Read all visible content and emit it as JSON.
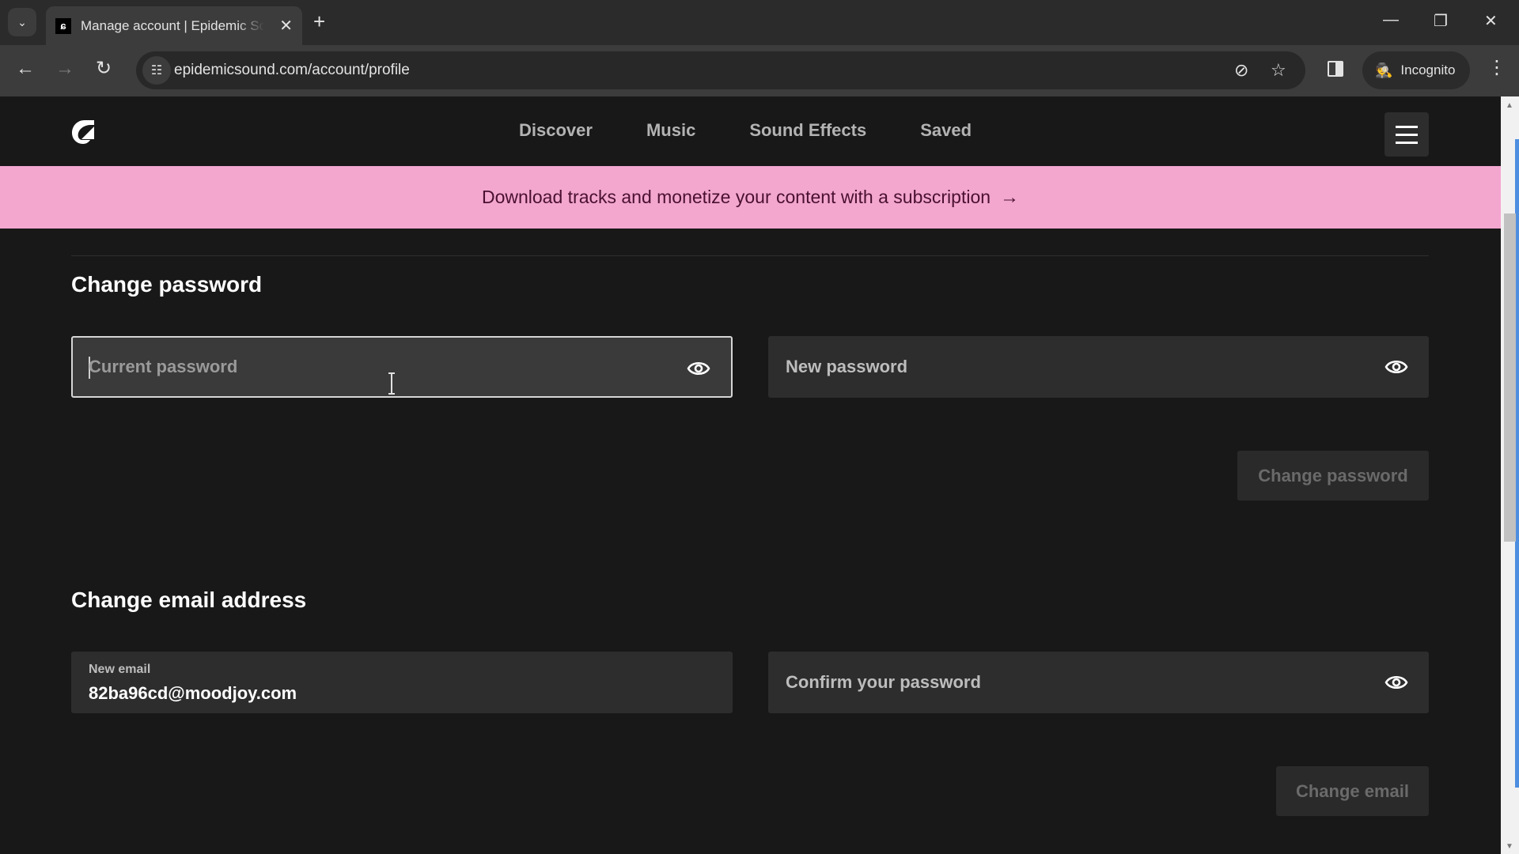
{
  "browser": {
    "tab": {
      "title": "Manage account | Epidemic Sound",
      "favicon": "epidemic-sound-logo"
    },
    "address_bar": {
      "url": "epidemicsound.com/account/profile"
    },
    "profile_label": "Incognito",
    "icons": {
      "tab_search": "⌄",
      "close": "✕",
      "new_tab": "+",
      "minimize": "—",
      "restore": "❐",
      "window_close": "✕",
      "back": "←",
      "forward": "→",
      "reload": "↻",
      "site_info": "☷",
      "eye_off": "⊘",
      "star": "☆",
      "incognito": "🕵",
      "more": "⋮"
    }
  },
  "site": {
    "nav": [
      {
        "label": "Discover"
      },
      {
        "label": "Music"
      },
      {
        "label": "Sound Effects"
      },
      {
        "label": "Saved"
      }
    ],
    "promo_banner": {
      "text": "Download tracks and monetize your content with a subscription",
      "arrow": "→",
      "background": "#f3a7cf"
    }
  },
  "change_password": {
    "title": "Change password",
    "current_password": {
      "placeholder": "Current password",
      "value": ""
    },
    "new_password": {
      "placeholder": "New password",
      "value": ""
    },
    "submit_label": "Change password"
  },
  "change_email": {
    "title": "Change email address",
    "new_email": {
      "label": "New email",
      "value": "82ba96cd@moodjoy.com"
    },
    "confirm_password": {
      "placeholder": "Confirm your password",
      "value": ""
    },
    "submit_label": "Change email"
  },
  "scrollbar": {
    "arrow_up": "▲",
    "arrow_down": "▼"
  }
}
